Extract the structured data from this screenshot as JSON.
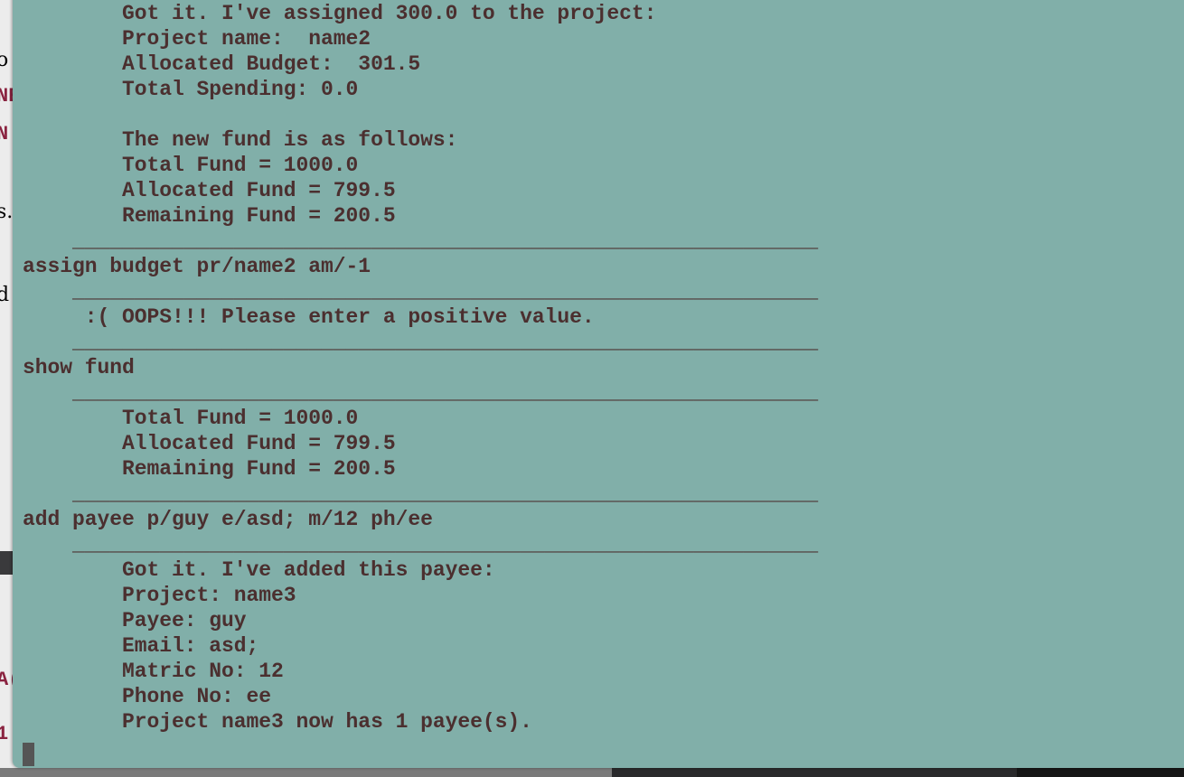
{
  "background_window": {
    "fragments": [
      "o",
      "NE",
      "N",
      "s.",
      "d",
      "A(",
      "1"
    ]
  },
  "terminal": {
    "lines": [
      "        Got it. I've assigned 300.0 to the project:",
      "        Project name:  name2",
      "        Allocated Budget:  301.5",
      "        Total Spending: 0.0",
      "",
      "        The new fund is as follows:",
      "        Total Fund = 1000.0",
      "        Allocated Fund = 799.5",
      "        Remaining Fund = 200.5",
      "    ____________________________________________________________",
      "assign budget pr/name2 am/-1",
      "    ____________________________________________________________",
      "     :( OOPS!!! Please enter a positive value.",
      "    ____________________________________________________________",
      "show fund",
      "    ____________________________________________________________",
      "        Total Fund = 1000.0",
      "        Allocated Fund = 799.5",
      "        Remaining Fund = 200.5",
      "    ____________________________________________________________",
      "add payee p/guy e/asd; m/12 ph/ee",
      "    ____________________________________________________________",
      "        Got it. I've added this payee:",
      "        Project: name3",
      "        Payee: guy",
      "        Email: asd;",
      "        Matric No: 12",
      "        Phone No: ee",
      "        Project name3 now has 1 payee(s)."
    ]
  }
}
